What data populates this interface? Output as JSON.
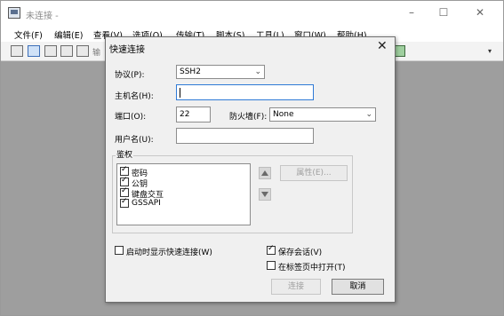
{
  "window": {
    "title": "未连接 -",
    "controls": {
      "minimize": "–",
      "maximize": "☐",
      "close": "✕"
    }
  },
  "menu": [
    "文件(F)",
    "编辑(E)",
    "查看(V)",
    "选项(O)",
    "传输(T)",
    "脚本(S)",
    "工具(L)",
    "窗口(W)",
    "帮助(H)"
  ],
  "toolbar": {
    "partial_label": "输",
    "overflow": "▾"
  },
  "dialog": {
    "title": "快速连接",
    "close": "✕",
    "protocol": {
      "label": "协议(P):",
      "value": "SSH2"
    },
    "hostname": {
      "label": "主机名(H):",
      "value": ""
    },
    "port": {
      "label": "端口(O):",
      "value": "22"
    },
    "firewall": {
      "label": "防火墙(F):",
      "value": "None"
    },
    "username": {
      "label": "用户名(U):",
      "value": ""
    },
    "auth": {
      "label": "鉴权",
      "items": [
        {
          "label": "密码",
          "checked": true
        },
        {
          "label": "公钥",
          "checked": true
        },
        {
          "label": "键盘交互",
          "checked": true
        },
        {
          "label": "GSSAPI",
          "checked": true
        }
      ],
      "properties_button": "属性(E)..."
    },
    "show_on_startup": {
      "label": "启动时显示快速连接(W)",
      "checked": false
    },
    "save_session": {
      "label": "保存会话(V)",
      "checked": true
    },
    "open_in_tab": {
      "label": "在标签页中打开(T)",
      "checked": false
    },
    "connect_button": "连接",
    "cancel_button": "取消"
  }
}
